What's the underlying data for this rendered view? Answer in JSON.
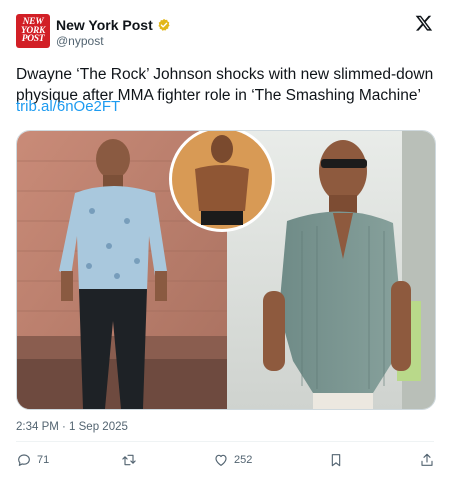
{
  "account": {
    "display_name": "New York Post",
    "handle": "@nypost",
    "logo_text": [
      "NEW",
      "YORK",
      "POST"
    ],
    "brand_color": "#d21f26",
    "verified_badge_color": "#e2b719"
  },
  "tweet": {
    "text_line1": "Dwayne ‘The Rock’ Johnson shocks with new slimmed-down",
    "text_line2": "physique after MMA fighter role in ‘The Smashing Machine’",
    "link": "trib.al/6nOe2FT",
    "timestamp": "2:34 PM · 1 Sep 2025"
  },
  "actions": {
    "replies": "71",
    "likes": "252"
  },
  "icons": [
    "x-logo-icon",
    "verified-badge-icon",
    "reply-icon",
    "retweet-icon",
    "like-icon",
    "bookmark-icon",
    "share-icon"
  ],
  "colors": {
    "link": "#1d9bf0",
    "muted": "#536471",
    "text": "#0f1419"
  }
}
